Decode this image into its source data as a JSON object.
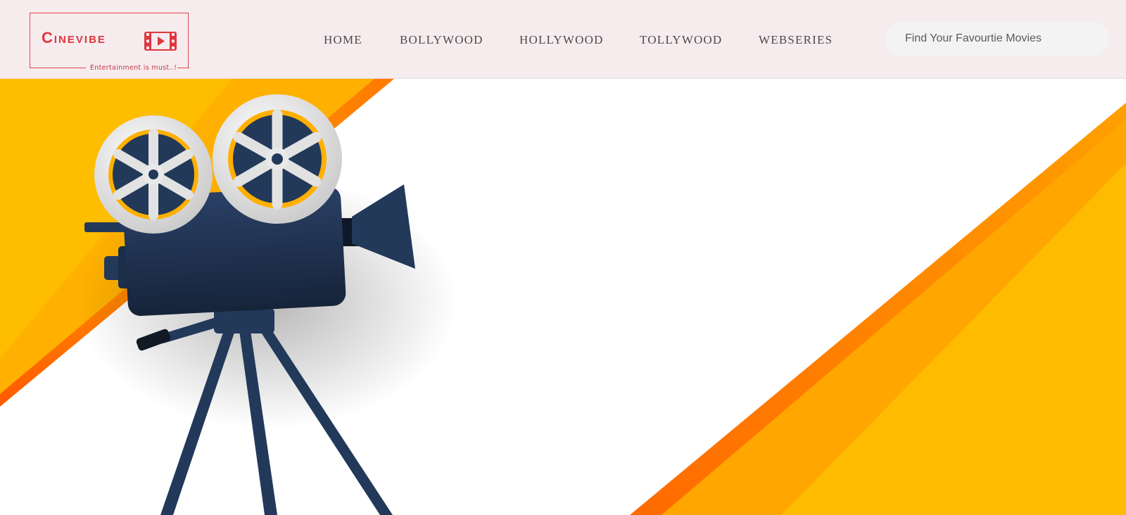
{
  "brand": {
    "name": "Cinevibe",
    "tagline": "Entertainment is must..!",
    "color": "#e0363f"
  },
  "nav": {
    "items": [
      {
        "label": "HOME"
      },
      {
        "label": "BOLLYWOOD"
      },
      {
        "label": "HOLLYWOOD"
      },
      {
        "label": "TOLLYWOOD"
      },
      {
        "label": "WEBSERIES"
      }
    ]
  },
  "search": {
    "value": "",
    "placeholder": "Find Your Favourtie Movies"
  },
  "hero": {
    "accent_color": "#ffbb00",
    "accent_dark": "#ff6a00",
    "camera_color": "#22395a",
    "icons": [
      "film-camera-icon",
      "film-reel-icon",
      "tripod-icon"
    ]
  }
}
